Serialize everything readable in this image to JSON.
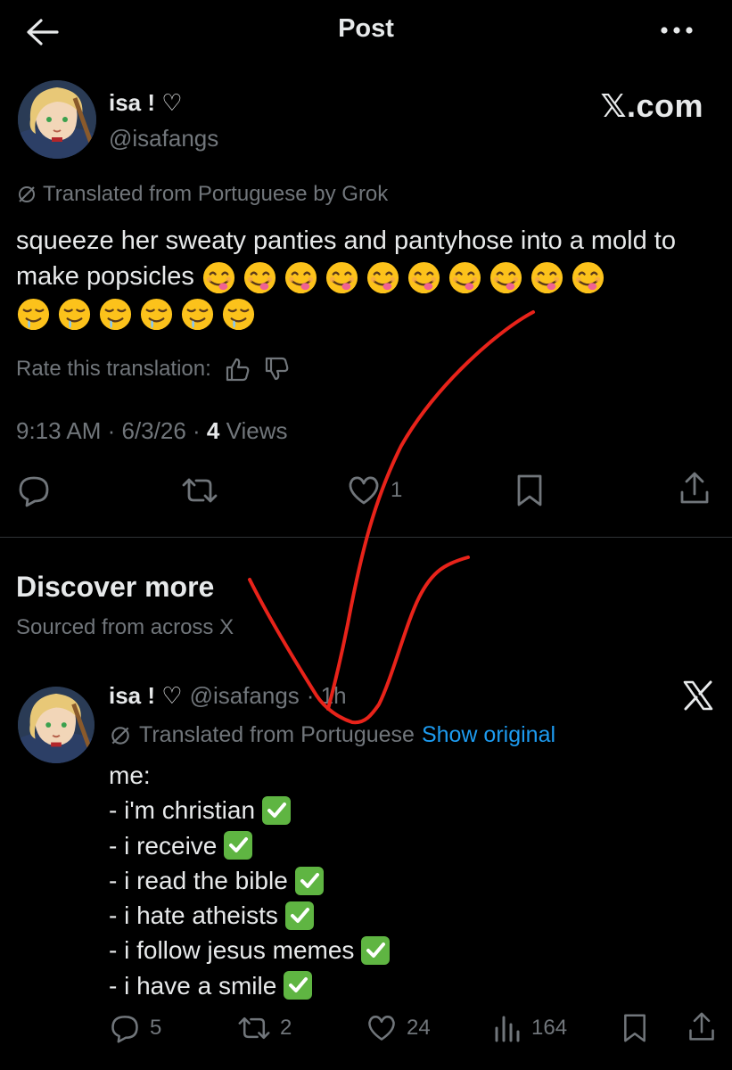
{
  "header": {
    "title": "Post"
  },
  "post": {
    "display_name": "isa ! ♡",
    "handle": "@isafangs",
    "watermark": "𝕏.com",
    "translated_label": "Translated from Portuguese by Grok",
    "text": "squeeze her sweaty panties and pantyhose into a mold to make popsicles",
    "emoji_yum_count": 10,
    "emoji_drool_count": 6,
    "rate_label": "Rate this translation:",
    "time": "9:13 AM · 6/3/26 · ",
    "views_count": "4",
    "views_label": " Views",
    "likes": "1"
  },
  "discover": {
    "title": "Discover more",
    "subtitle": "Sourced from across X"
  },
  "post2": {
    "display_name": "isa ! ♡",
    "handle": "@isafangs",
    "time": "· 1h",
    "translated_label": "Translated from Portuguese",
    "show_original": "Show original",
    "lines": [
      "me:",
      "- i'm christian",
      "- i receive",
      "- i read the bible",
      "- i hate atheists",
      "- i follow jesus memes",
      "- i have a smile"
    ],
    "replies": "5",
    "reposts": "2",
    "likes": "24",
    "views": "164"
  },
  "colors": {
    "background": "#000000",
    "text": "#e7e9ea",
    "muted": "#71767b",
    "link": "#1d9bf0",
    "annotation": "#e8231a",
    "check": "#5fb542"
  }
}
